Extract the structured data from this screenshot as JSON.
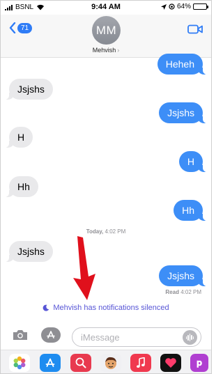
{
  "status_bar": {
    "carrier": "BSNL",
    "time": "9:44 AM",
    "battery": "64%",
    "battery_level": 0.64
  },
  "header": {
    "back_count": "71",
    "avatar_initials": "MM",
    "contact_name": "Mehvish",
    "contact_chevron": "›"
  },
  "messages": [
    {
      "direction": "outgoing",
      "text": "Heheh"
    },
    {
      "direction": "incoming",
      "text": "Jsjshs"
    },
    {
      "direction": "outgoing",
      "text": "Jsjshs"
    },
    {
      "direction": "incoming",
      "text": "H"
    },
    {
      "direction": "outgoing",
      "text": "H"
    },
    {
      "direction": "incoming",
      "text": "Hh"
    },
    {
      "direction": "outgoing",
      "text": "Hh"
    },
    {
      "direction": "incoming",
      "text": "Jsjshs"
    },
    {
      "direction": "outgoing",
      "text": "Jsjshs"
    }
  ],
  "timestamp": {
    "day": "Today,",
    "time": "4:02 PM"
  },
  "read_receipt": {
    "label": "Read",
    "time": "4:02 PM"
  },
  "notice": {
    "text": "Mehvish has notifications silenced",
    "color": "#5856d6"
  },
  "composer": {
    "placeholder": "iMessage"
  },
  "app_drawer": [
    "photos-app",
    "app-store-app",
    "web-search-app",
    "memoji-app",
    "music-app",
    "digital-touch-app",
    "more-app"
  ],
  "colors": {
    "outgoing_bubble": "#3d8ef7",
    "incoming_bubble": "#e9e9eb",
    "accent": "#2f7cf6",
    "arrow": "#e0101c"
  }
}
